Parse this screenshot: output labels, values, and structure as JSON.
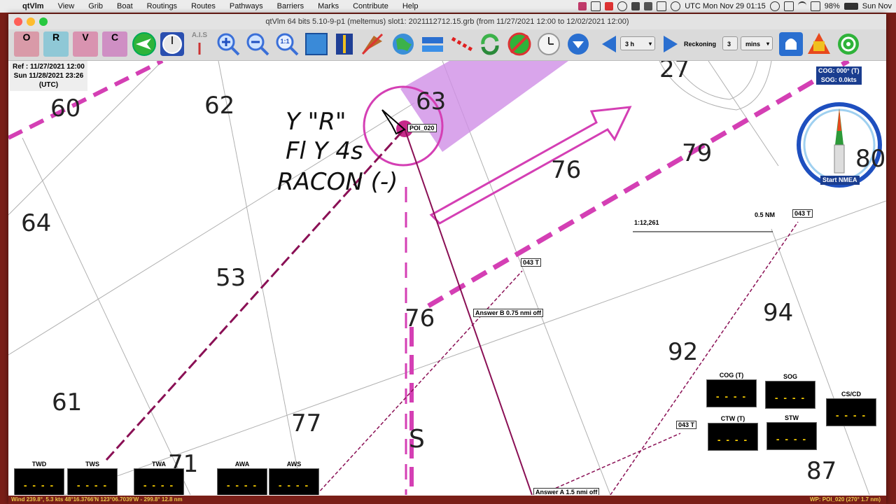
{
  "menubar": {
    "app": "qtVlm",
    "items": [
      "View",
      "Grib",
      "Boat",
      "Routings",
      "Routes",
      "Pathways",
      "Barriers",
      "Marks",
      "Contribute",
      "Help"
    ],
    "clock": "UTC Mon Nov 29  01:15",
    "battery": "98%",
    "date_short": "Sun Nov"
  },
  "window": {
    "title": "qtVlm 64 bits 5.10-9-p1 (meltemus) slot1: 2021112712.15.grb (from 11/27/2021 12:00 to 12/02/2021 12:00)"
  },
  "toolbar": {
    "letters": [
      "O",
      "R",
      "V",
      "C"
    ],
    "ais_label": "A.I.S",
    "zoom_fit": "1:1",
    "step": "3 h",
    "reckoning_label": "Reckoning",
    "reckoning_value": "3",
    "reckoning_unit": "mins"
  },
  "chart": {
    "ref_line1": "Ref : 11/27/2021 12:00",
    "ref_line2": "Sun 11/28/2021 23:26",
    "ref_line3": "(UTC)",
    "depths": [
      "60",
      "62",
      "63",
      "64",
      "53",
      "76",
      "76",
      "79",
      "80",
      "94",
      "92",
      "61",
      "77",
      "71",
      "87",
      "27"
    ],
    "buoy": {
      "line1": "Y \"R\"",
      "line2": "Fl Y 4s",
      "line3": "RACON (-)"
    },
    "letter_s": "S",
    "poi": "POI_020",
    "scale_text": "1:12,261",
    "scale_nm": "0.5 NM",
    "bearing_tags": [
      "043 T",
      "043 T",
      "043 T"
    ],
    "answer_b": "Answer B  0.75 nmi off",
    "answer_a": "Answer A  1.5 nmi off",
    "cog": "COG: 000° (T)",
    "sog": "SOG: 0.0kts",
    "start_nmea": "Start NMEA"
  },
  "instruments_bottom": [
    "TWD",
    "TWS",
    "TWA",
    "AWA",
    "AWS"
  ],
  "instruments_right": [
    "COG (T)",
    "SOG",
    "CS/CD",
    "CTW (T)",
    "STW"
  ],
  "instrument_value": "- - - -",
  "statusbar": {
    "left": "Wind 239.8°, 5.3 kts 48°16.3766'N 123°06.7039'W - 299.8° 12.8 nm",
    "right": "WP: POI_020 (270° 1.7 nm)"
  },
  "colors": {
    "route": "#8a1055",
    "magenta": "#d43fb4",
    "sector": "#cf8fe6",
    "toolbar": "#dadada"
  }
}
